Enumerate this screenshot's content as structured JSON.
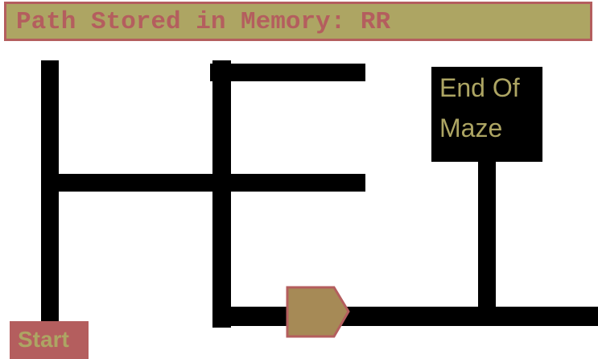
{
  "banner": {
    "text": "Path Stored in Memory: RR"
  },
  "end": {
    "line1": "End Of",
    "line2": "Maze"
  },
  "start": {
    "label": "Start"
  },
  "colors": {
    "banner_bg": "#ada563",
    "accent": "#b45e5e",
    "wall": "#000000",
    "robot_fill": "#a68a56"
  },
  "robot": {
    "icon": "robot-arrow-icon"
  }
}
